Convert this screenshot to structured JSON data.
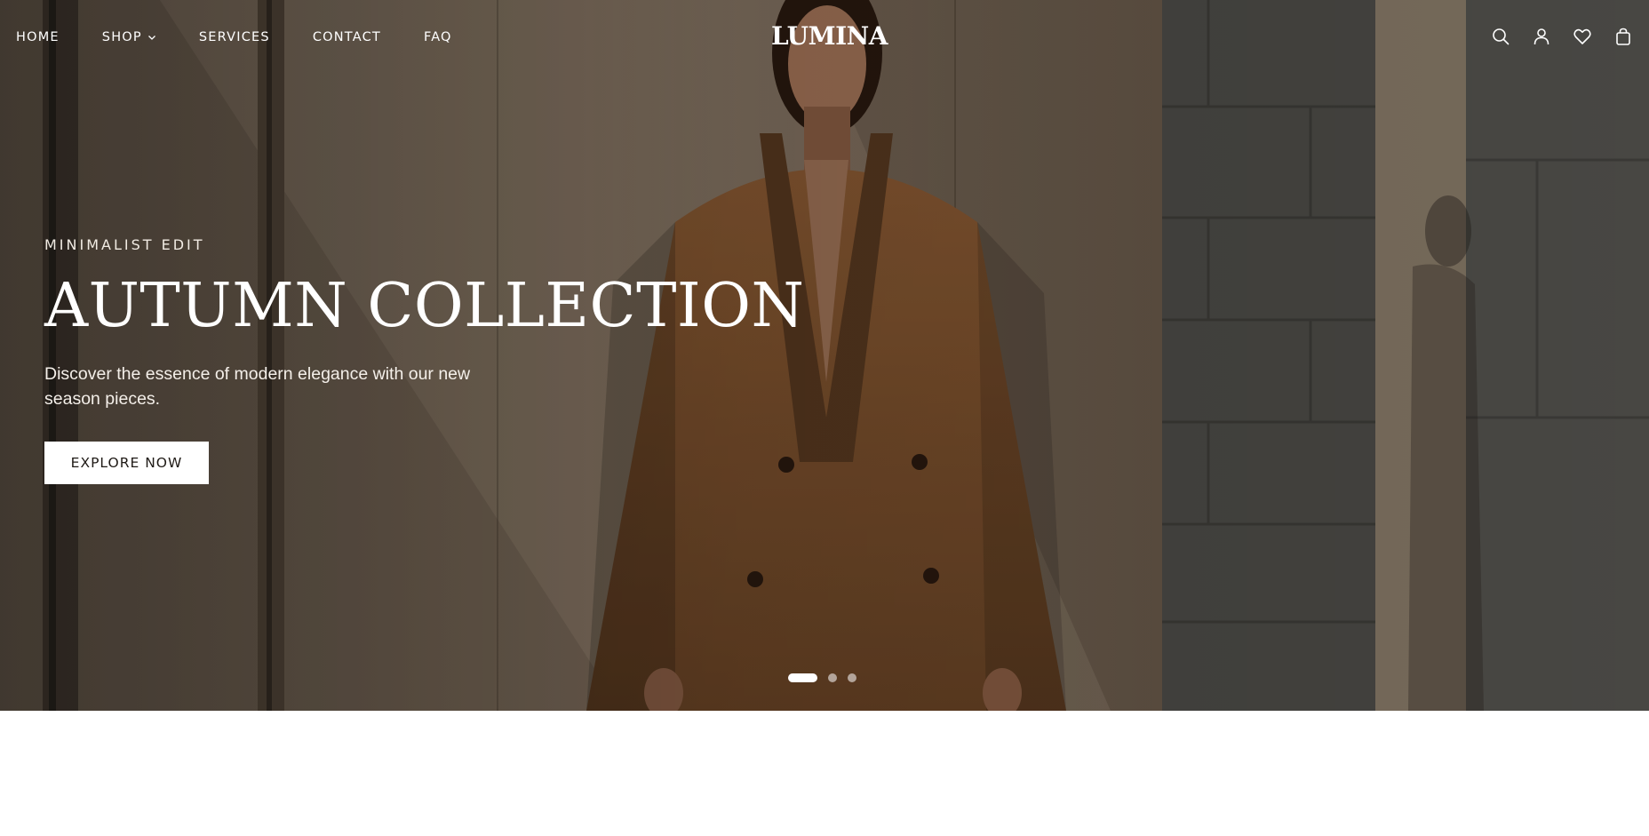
{
  "brand": {
    "logo": "LUMINA"
  },
  "nav": {
    "links": [
      {
        "label": "HOME"
      },
      {
        "label": "SHOP",
        "has_dropdown": true
      },
      {
        "label": "SERVICES"
      },
      {
        "label": "CONTACT"
      },
      {
        "label": "FAQ"
      }
    ],
    "icons": [
      "search-icon",
      "account-icon",
      "wishlist-icon",
      "cart-icon"
    ]
  },
  "hero": {
    "eyebrow": "MINIMALIST EDIT",
    "title": "AUTUMN COLLECTION",
    "subtitle": "Discover the essence of modern elegance with our new season pieces.",
    "cta_label": "EXPLORE NOW",
    "slides": {
      "count": 3,
      "active": 1
    }
  },
  "colors": {
    "text_on_hero": "#ffffff",
    "coat": "#8a5a32",
    "page_background": "#ffffff"
  }
}
